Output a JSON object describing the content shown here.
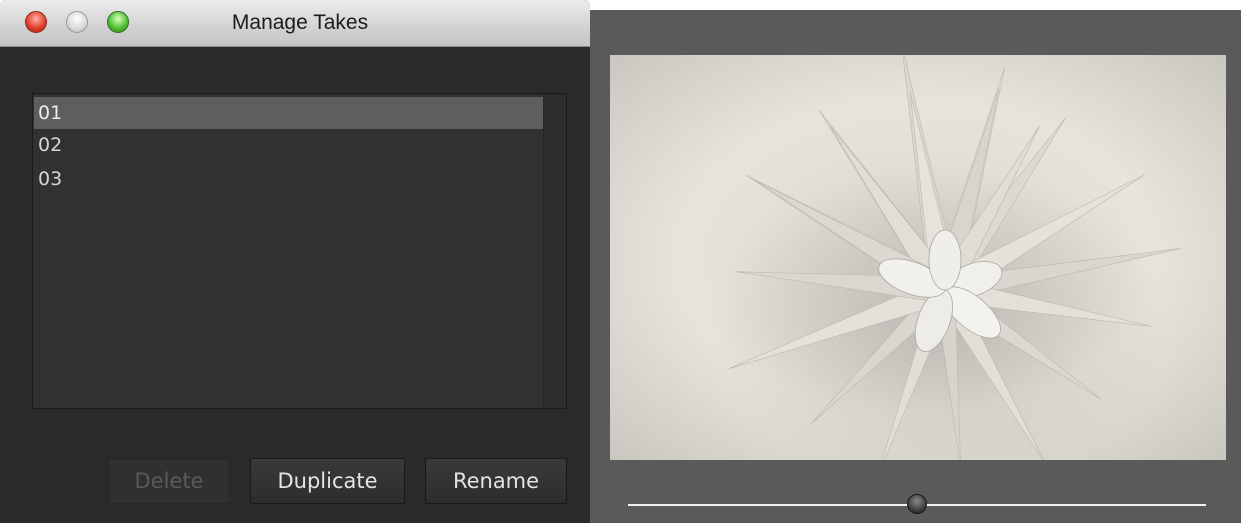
{
  "window": {
    "title": "Manage Takes"
  },
  "takes": {
    "items": [
      "01",
      "02",
      "03"
    ],
    "selected_index": 0
  },
  "buttons": {
    "delete_label": "Delete",
    "delete_enabled": false,
    "duplicate_label": "Duplicate",
    "rename_label": "Rename"
  },
  "viewer": {
    "slider_value_fraction": 0.5,
    "photo_subject": "spiky-plant-closeup"
  },
  "colors": {
    "window_bg": "#2a2a2a",
    "selection": "#5e5e5e",
    "viewer_bg": "#5a5a5a"
  }
}
